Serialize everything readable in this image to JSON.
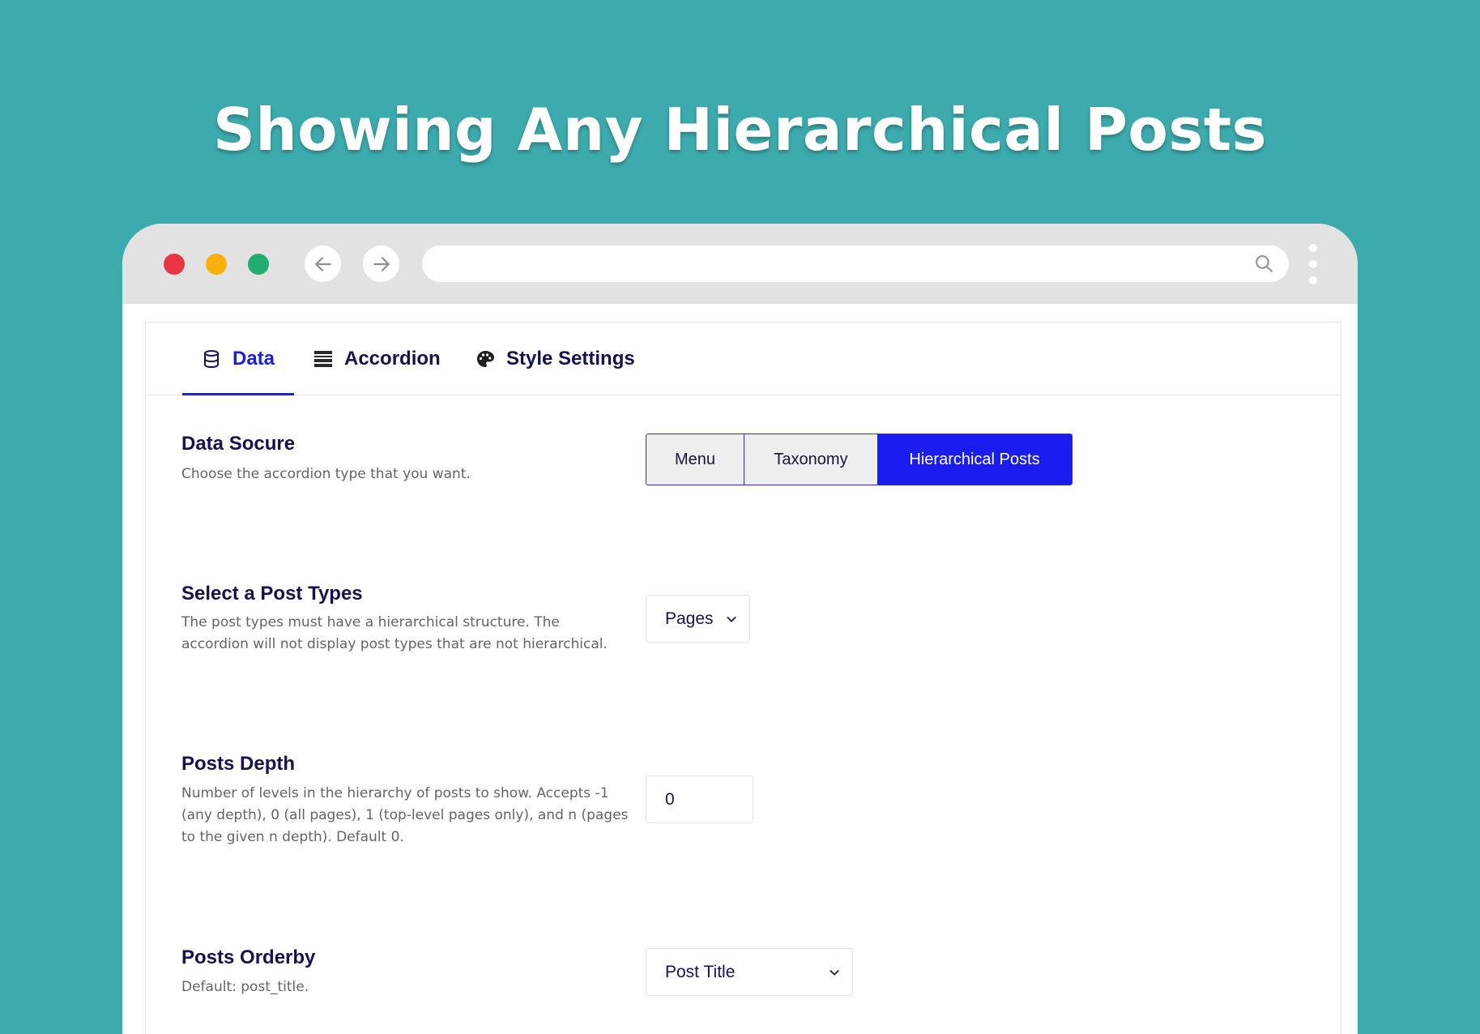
{
  "hero": {
    "title": "Showing Any Hierarchical Posts"
  },
  "browser": {
    "traffic_lights": [
      "#ea3443",
      "#f8b00b",
      "#21ad71"
    ],
    "address_value": "",
    "icons": [
      "arrow-left-icon",
      "arrow-right-icon",
      "search-icon",
      "kebab-menu-icon"
    ]
  },
  "tabs": [
    {
      "label": "Data",
      "icon": "database-icon",
      "active": true
    },
    {
      "label": "Accordion",
      "icon": "accordion-icon",
      "active": false
    },
    {
      "label": "Style Settings",
      "icon": "palette-icon",
      "active": false
    }
  ],
  "fields": {
    "data_source": {
      "title": "Data Socure",
      "description": "Choose the accordion type that you want.",
      "options": [
        "Menu",
        "Taxonomy",
        "Hierarchical Posts"
      ],
      "selected": "Hierarchical Posts"
    },
    "post_types": {
      "title": "Select a Post Types",
      "description": "The post types must have a hierarchical structure. The accordion will not display post types that are not hierarchical.",
      "value": "Pages"
    },
    "posts_depth": {
      "title": "Posts Depth",
      "description": "Number of levels in the hierarchy of posts to show. Accepts -1 (any depth), 0 (all pages), 1 (top-level pages only), and n (pages to the given n depth). Default 0.",
      "value": "0"
    },
    "posts_orderby": {
      "title": "Posts Orderby",
      "description": "Default: post_title.",
      "value": "Post Title"
    }
  },
  "colors": {
    "background": "#3dabad",
    "accent": "#1a1cf0",
    "heading": "#14134f"
  }
}
